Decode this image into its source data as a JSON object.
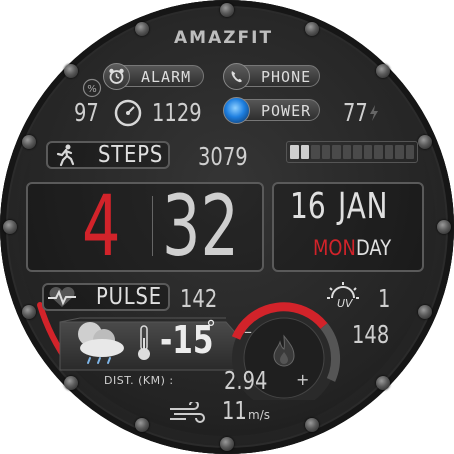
{
  "brand": "AMAZFIT",
  "buttons": {
    "alarm": "ALARM",
    "phone": "PHONE",
    "power": "POWER"
  },
  "battery": {
    "value": "97"
  },
  "calories": {
    "value": "1129"
  },
  "power_percent": {
    "value": "77"
  },
  "steps": {
    "label": "STEPS",
    "value": "3079",
    "progress_fraction": 0.2
  },
  "time": {
    "hour": "4",
    "minute": "32"
  },
  "date": {
    "day": "16",
    "month": "JAN",
    "weekday_highlight": "MON",
    "weekday_rest": "DAY"
  },
  "pulse": {
    "label": "PULSE",
    "value": "142"
  },
  "uv": {
    "label": "UV",
    "value": "1"
  },
  "stat_148": {
    "value": "148"
  },
  "weather": {
    "temperature": "-15",
    "unit": "°"
  },
  "gauge": {
    "minus": "–",
    "plus": "+"
  },
  "distance": {
    "label": "DIST. (KM) :",
    "value": "2.94"
  },
  "wind": {
    "value": "11",
    "unit": "m/s"
  },
  "colors": {
    "accent_red": "#d2232a",
    "text": "#d8d8d8",
    "power_blue": "#1e7fe0"
  },
  "icons": [
    "alarm-clock-icon",
    "phone-icon",
    "power-orb-icon",
    "speedometer-icon",
    "battery-percent-icon",
    "running-man-icon",
    "heart-pulse-icon",
    "uv-sun-icon",
    "weather-cloud-icon",
    "thermometer-icon",
    "flame-icon",
    "wind-icon",
    "bolt-icon"
  ]
}
